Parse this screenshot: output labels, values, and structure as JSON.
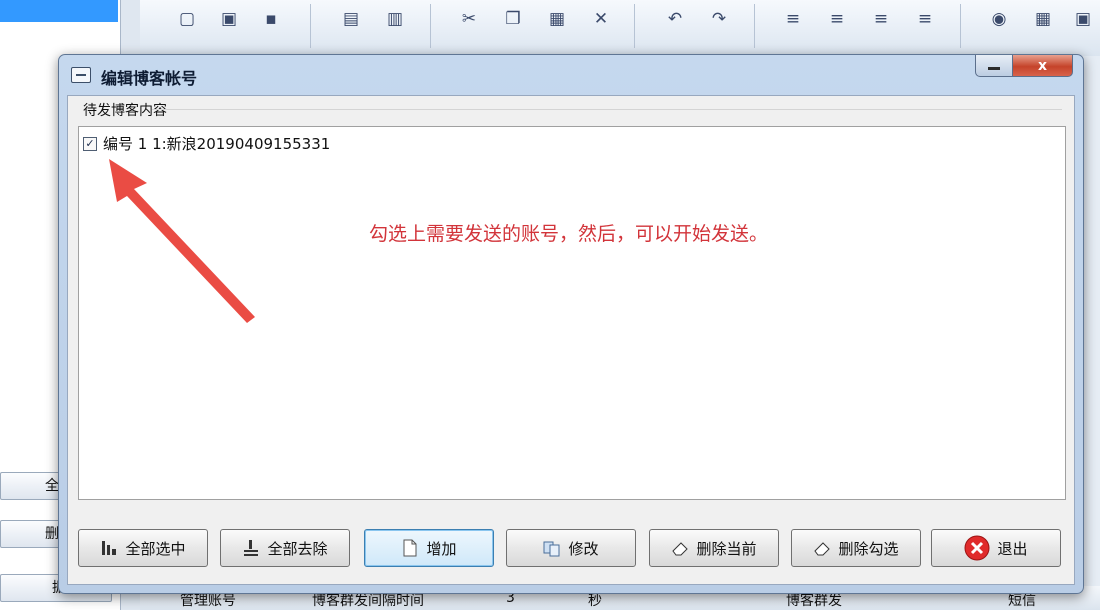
{
  "window": {
    "title": "编辑博客帐号",
    "close_glyph": "x"
  },
  "group": {
    "label": "待发博客内容"
  },
  "list": {
    "items": [
      {
        "label": "编号 1 1:新浪20190409155331",
        "checked": true
      }
    ]
  },
  "annotation": "勾选上需要发送的账号，然后，可以开始发送。",
  "buttons": {
    "select_all": "全部选中",
    "deselect_all": "全部去除",
    "add": "增加",
    "modify": "修改",
    "delete_current": "删除当前",
    "delete_checked": "删除勾选",
    "exit": "退出"
  },
  "background": {
    "left_btn_1": "全部",
    "left_btn_2": "删除",
    "left_btn_3": "据",
    "bottom_manage": "管理账号",
    "bottom_interval": "博客群发间隔时间",
    "bottom_value": "3",
    "bottom_unit": "秒",
    "bottom_combo": "博客群发",
    "bottom_sms": "短信"
  },
  "colors": {
    "annotation": "#d2343a",
    "close_button": "#c5432a",
    "title_bar": "#c5d8ee"
  }
}
